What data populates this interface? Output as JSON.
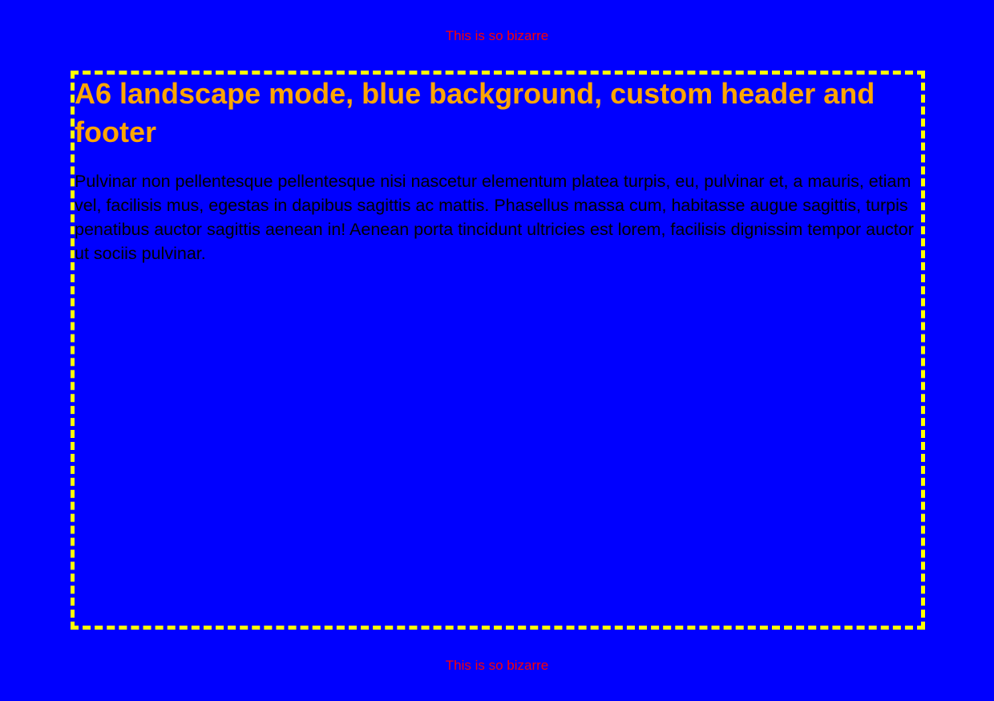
{
  "header": {
    "text": "This is so bizarre",
    "color": "#ff0000"
  },
  "footer": {
    "text": "This is so bizarre",
    "color": "#ff0000"
  },
  "page": {
    "background_color": "#0000ff",
    "border_color": "#ffff00",
    "border_style": "dashed"
  },
  "content": {
    "title": "A6 landscape mode, blue background, custom header and footer",
    "title_color": "#ffa500",
    "paragraph": "Pulvinar non pellentesque pellentesque nisi nascetur elementum platea turpis, eu, pulvinar et, a mauris, etiam vel, facilisis mus, egestas in dapibus sagittis ac mattis. Phasellus massa cum, habitasse augue sagittis, turpis penatibus auctor sagittis aenean in! Aenean porta tincidunt ultricies est lorem, facilisis dignissim tempor auctor ut sociis pulvinar.",
    "paragraph_color": "#000000"
  }
}
